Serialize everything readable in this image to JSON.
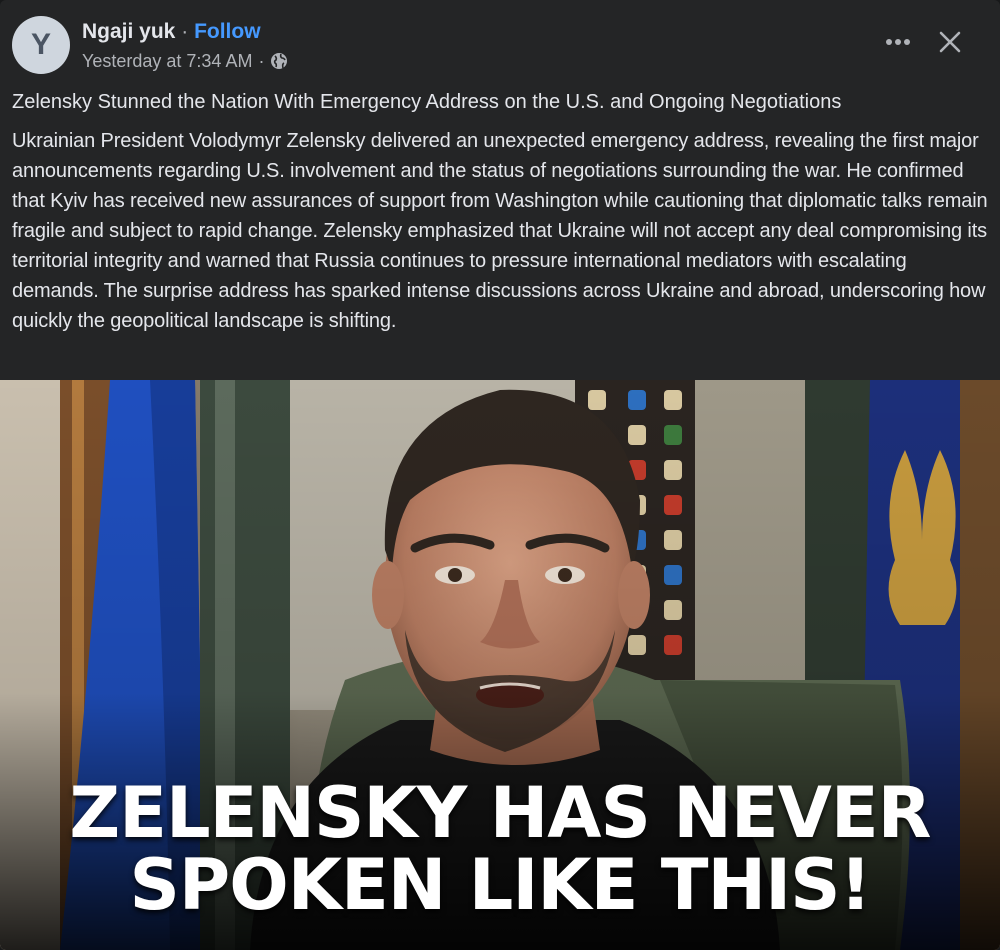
{
  "post": {
    "author": {
      "avatar_letter": "Y",
      "name": "Ngaji yuk",
      "separator": "·",
      "follow_label": "Follow"
    },
    "meta": {
      "timestamp": "Yesterday at 7:34 AM",
      "separator": "·",
      "audience_icon": "globe-icon"
    },
    "actions": {
      "more_icon": "more-icon",
      "close_icon": "close-icon"
    },
    "title": "Zelensky Stunned the Nation With Emergency Address on the U.S. and Ongoing Negotiations",
    "body": "Ukrainian President Volodymyr Zelensky delivered an unexpected emergency address, revealing the first major announcements regarding U.S. involvement and the status of negotiations surrounding the war. He confirmed that Kyiv has received new assurances of support from Washington while cautioning that diplomatic talks remain fragile and subject to rapid change. Zelensky emphasized that Ukraine will not accept any deal compromising its territorial integrity and warned that Russia continues to pressure international mediators with escalating demands. The surprise address has sparked intense discussions across Ukraine and abroad, underscoring how quickly the geopolitical landscape is shifting.",
    "image": {
      "headline_line1": "ZELENSKY HAS NEVER",
      "headline_line2": "SPOKEN LIKE THIS!"
    }
  },
  "colors": {
    "card_background": "#242526",
    "primary_text": "#e4e6eb",
    "secondary_text": "#b0b3b8",
    "follow_link": "#4599ff",
    "avatar_background": "#cfd6de"
  }
}
